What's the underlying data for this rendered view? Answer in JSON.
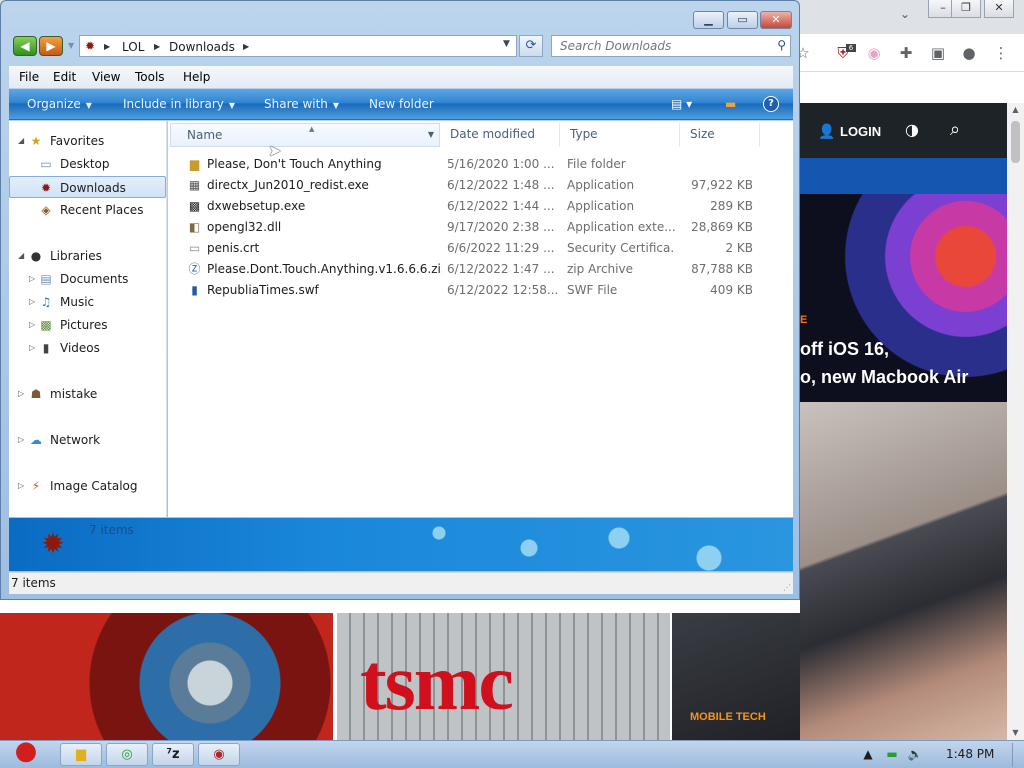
{
  "browser": {
    "site": {
      "login_label": "LOGIN",
      "hero_kicker": "E",
      "hero_title": "off iOS 16,\no, new Macbook Air",
      "bottom_category": "MOBILE TECH",
      "tsmc_logo": "tsmc"
    },
    "toolbar_icons": [
      "star-icon",
      "extension-shield-icon",
      "translate-icon",
      "puzzle-icon",
      "sidepanel-icon",
      "profile-icon",
      "kebab-menu-icon"
    ],
    "extension_badge": "6"
  },
  "explorer": {
    "title_buttons": [
      "minimize",
      "maximize",
      "close"
    ],
    "address": {
      "crumbs": [
        "LOL",
        "Downloads"
      ]
    },
    "search": {
      "placeholder": "Search Downloads"
    },
    "menu": [
      "File",
      "Edit",
      "View",
      "Tools",
      "Help"
    ],
    "commands": {
      "organize": "Organize",
      "include": "Include in library",
      "share": "Share with",
      "new_folder": "New folder"
    },
    "nav": {
      "favorites": "Favorites",
      "desktop": "Desktop",
      "downloads": "Downloads",
      "recent": "Recent Places",
      "libraries": "Libraries",
      "documents": "Documents",
      "music": "Music",
      "pictures": "Pictures",
      "videos": "Videos",
      "mistake": "mistake",
      "network": "Network",
      "image_catalog": "Image Catalog"
    },
    "columns": {
      "name": "Name",
      "date": "Date modified",
      "type": "Type",
      "size": "Size"
    },
    "files": [
      {
        "name": "Please, Don't Touch Anything",
        "date": "5/16/2020 1:00 ...",
        "type": "File folder",
        "size": "",
        "icon": "folder-icon"
      },
      {
        "name": "directx_Jun2010_redist.exe",
        "date": "6/12/2022 1:48 ...",
        "type": "Application",
        "size": "97,922 KB",
        "icon": "exe-icon"
      },
      {
        "name": "dxwebsetup.exe",
        "date": "6/12/2022 1:44 ...",
        "type": "Application",
        "size": "289 KB",
        "icon": "exe-icon"
      },
      {
        "name": "opengl32.dll",
        "date": "9/17/2020 2:38 ...",
        "type": "Application exte...",
        "size": "28,869 KB",
        "icon": "dll-icon"
      },
      {
        "name": "penis.crt",
        "date": "6/6/2022 11:29 ...",
        "type": "Security Certifica...",
        "size": "2 KB",
        "icon": "certificate-icon"
      },
      {
        "name": "Please.Dont.Touch.Anything.v1.6.6.6.zip",
        "date": "6/12/2022 1:47 ...",
        "type": "zip Archive",
        "size": "87,788 KB",
        "icon": "zip-icon"
      },
      {
        "name": "RepubliaTimes.swf",
        "date": "6/12/2022 12:58...",
        "type": "SWF File",
        "size": "409 KB",
        "icon": "swf-icon"
      }
    ],
    "details_count": "7 items",
    "status_count": "7 items"
  },
  "taskbar": {
    "clock": "1:48 PM",
    "tasks": [
      "explorer-task-icon",
      "chrome-task-icon",
      "7zip-task-icon",
      "game-task-icon"
    ]
  },
  "colors": {
    "command_bar": "#2f86d2",
    "site_dark": "#1d2327",
    "site_blue": "#1557b0",
    "accent_orange": "#f7931e"
  }
}
